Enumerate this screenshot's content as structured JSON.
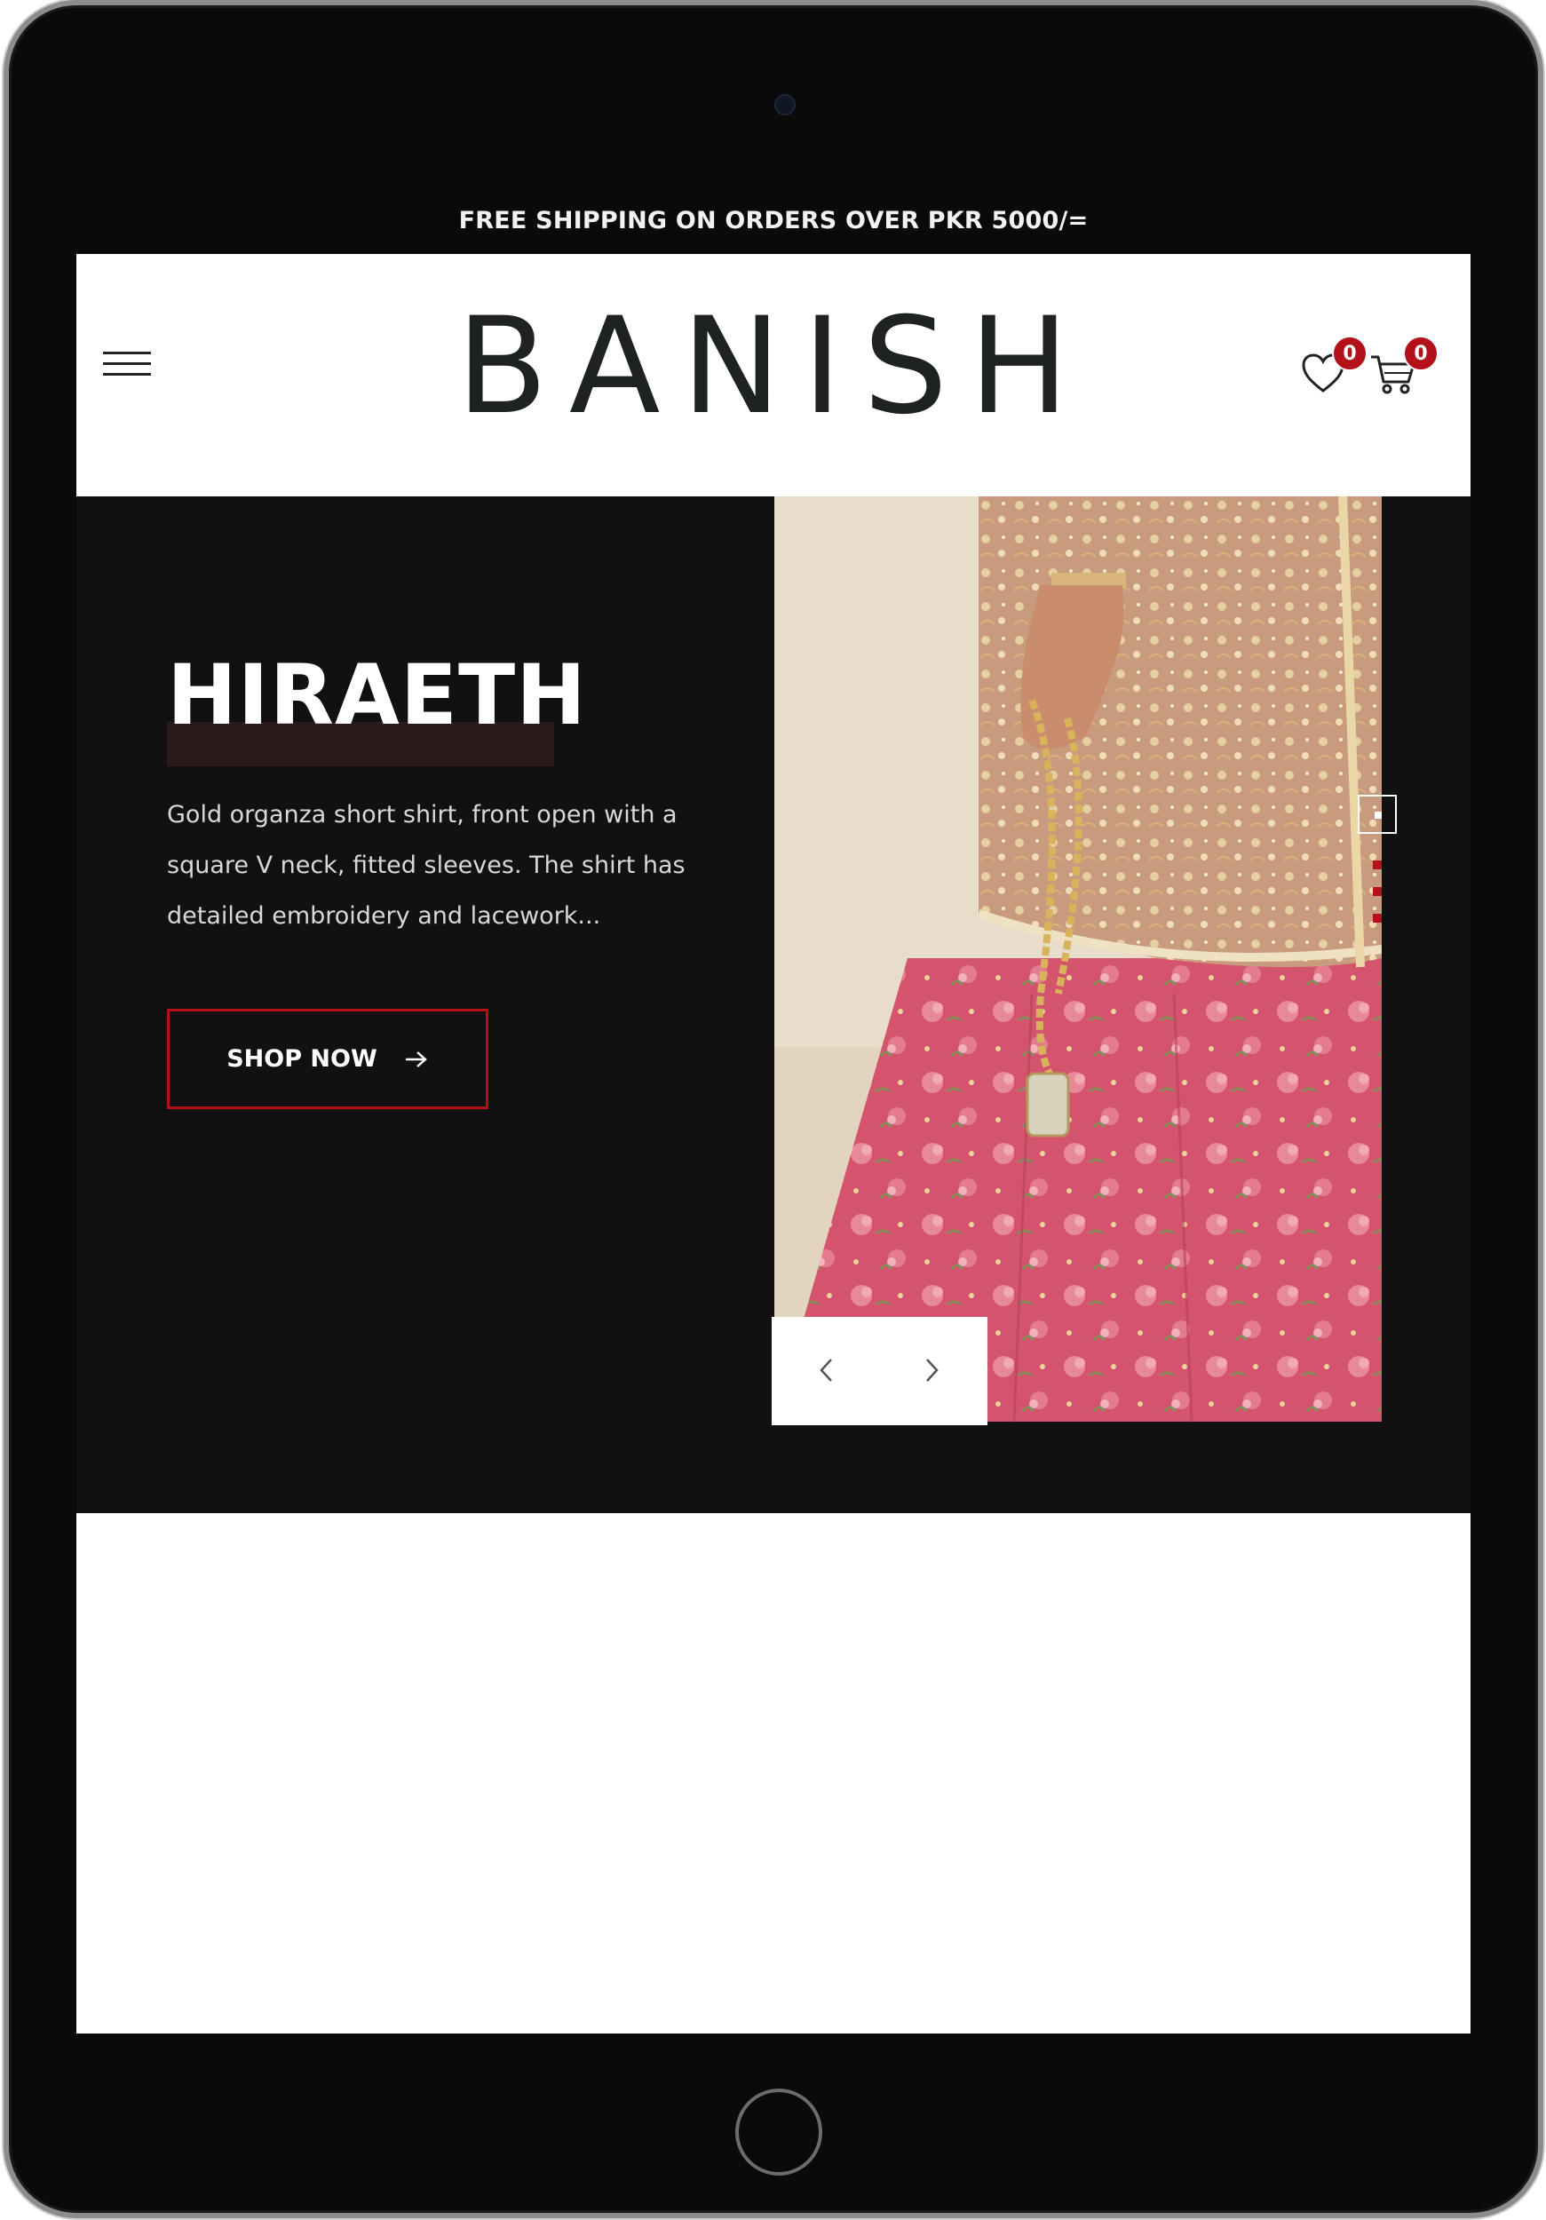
{
  "announcement": "FREE SHIPPING ON ORDERS OVER PKR 5000/=",
  "brand": {
    "logo": "BANISH"
  },
  "header": {
    "wishlist_count": "0",
    "cart_count": "0"
  },
  "hero": {
    "title": "HIRAETH",
    "description": "Gold organza short shirt, front open with a square V neck, fitted sleeves. The shirt has detailed embroidery and lacework...",
    "cta_label": "SHOP NOW",
    "image_label": "Model wearing embroidered gold organza short shirt with pink floral lehenga"
  },
  "colors": {
    "accent": "#b3121b",
    "hero_bg": "#111112",
    "text_light": "#ffffff"
  },
  "icons": [
    "menu-icon",
    "heart-icon",
    "cart-icon",
    "arrow-right-icon",
    "chevron-left-icon",
    "chevron-right-icon"
  ]
}
